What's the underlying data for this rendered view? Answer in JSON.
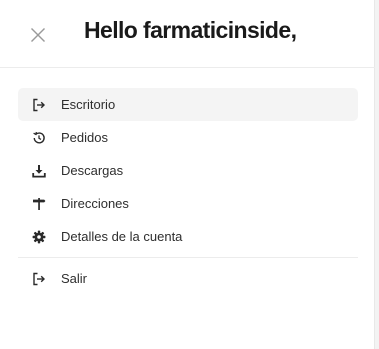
{
  "header": {
    "greeting": "Hello farmaticinside,"
  },
  "menu": {
    "items": [
      {
        "label": "Escritorio",
        "icon": "logout-arrow-icon",
        "active": true
      },
      {
        "label": "Pedidos",
        "icon": "history-icon",
        "active": false
      },
      {
        "label": "Descargas",
        "icon": "download-icon",
        "active": false
      },
      {
        "label": "Direcciones",
        "icon": "signpost-icon",
        "active": false
      },
      {
        "label": "Detalles de la cuenta",
        "icon": "gear-icon",
        "active": false
      }
    ],
    "logout": {
      "label": "Salir",
      "icon": "logout-arrow-icon"
    }
  },
  "colors": {
    "active_bg": "#f4f4f4",
    "text": "#2e2e2e",
    "divider": "#ececec"
  }
}
